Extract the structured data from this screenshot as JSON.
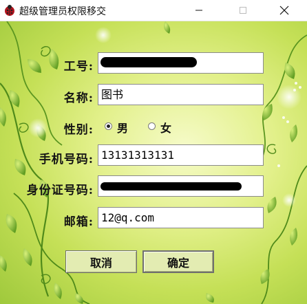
{
  "window": {
    "title": "超级管理员权限移交",
    "icon": "ladybug-icon",
    "controls": [
      "minimize-icon",
      "maximize-icon",
      "close-icon"
    ]
  },
  "form": {
    "employee_id_label": "工号:",
    "name_label": "名称:",
    "name_value": "图书",
    "gender_label": "性别:",
    "gender_options": [
      "男",
      "女"
    ],
    "gender_selected": "男",
    "phone_label": "手机号码:",
    "phone_value": "13131313131",
    "id_card_label": "身份证号码:",
    "email_label": "邮箱:",
    "email_value": "12@q.com"
  },
  "buttons": {
    "cancel_label": "取消",
    "confirm_label": "确定"
  }
}
